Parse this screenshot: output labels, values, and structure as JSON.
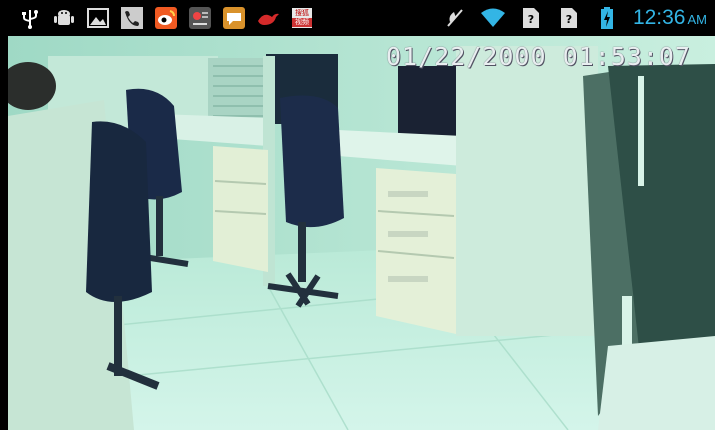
{
  "status_bar": {
    "notification_icons": [
      "usb-icon",
      "android-debug-icon",
      "gallery-icon",
      "phone-icon",
      "weibo-icon",
      "app-icon",
      "chat-icon",
      "bird-icon",
      "cn-news-icon"
    ],
    "cn_badge": {
      "top": "搜狐",
      "bottom": "视频"
    },
    "system_icons": [
      "mute-icon",
      "wifi-icon",
      "no-sim-icon",
      "no-sim-icon",
      "battery-charging-icon"
    ],
    "time": "12:36",
    "ampm": "AM",
    "colors": {
      "clock": "#33b5e5",
      "background": "#000000"
    }
  },
  "video": {
    "timestamp": "01/22/2000  01:53:07"
  }
}
